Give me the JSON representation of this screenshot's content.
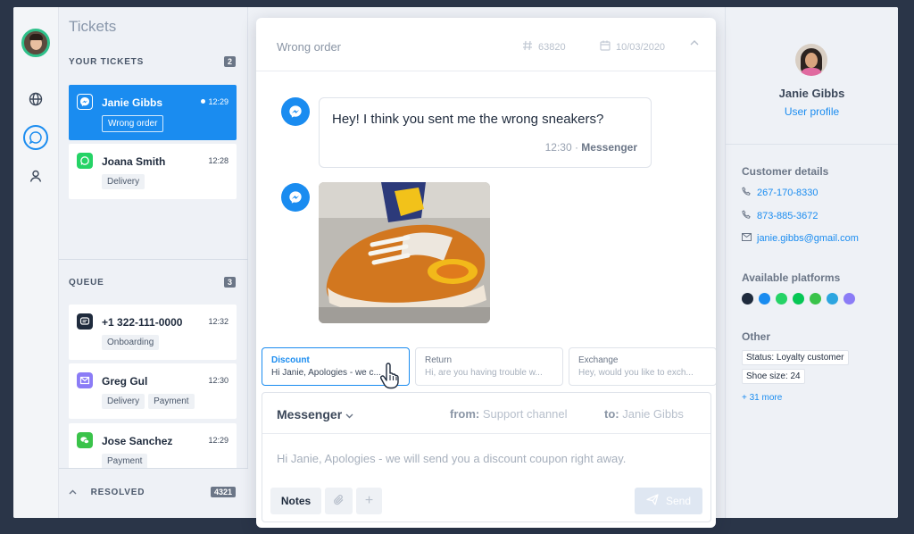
{
  "tickets": {
    "title": "Tickets",
    "your_label": "YOUR TICKETS",
    "your_count": "2",
    "your_items": [
      {
        "name": "Janie Gibbs",
        "time": "12:29",
        "tags": [
          "Wrong order"
        ]
      },
      {
        "name": "Joana Smith",
        "time": "12:28",
        "tags": [
          "Delivery"
        ]
      }
    ],
    "queue_label": "QUEUE",
    "queue_count": "3",
    "queue_items": [
      {
        "name": "+1 322-111-0000",
        "time": "12:32",
        "tags": [
          "Onboarding"
        ]
      },
      {
        "name": "Greg Gul",
        "time": "12:30",
        "tags": [
          "Delivery",
          "Payment"
        ]
      },
      {
        "name": "Jose Sanchez",
        "time": "12:29",
        "tags": [
          "Payment"
        ]
      }
    ],
    "resolved_label": "RESOLVED",
    "resolved_count": "4321"
  },
  "chat": {
    "title": "Wrong order",
    "ticket_id": "63820",
    "date": "10/03/2020",
    "message": "Hey! I think you sent me the wrong sneakers?",
    "message_time": "12:30 · ",
    "message_channel": "Messenger"
  },
  "quick_replies": [
    {
      "title": "Discount",
      "body": "Hi Janie, Apologies - we c..."
    },
    {
      "title": "Return",
      "body": "Hi, are you having trouble w..."
    },
    {
      "title": "Exchange",
      "body": "Hey, would you like to exch..."
    }
  ],
  "composer": {
    "channel": "Messenger",
    "from_label": "from:",
    "from_value": "Support channel",
    "to_label": "to:",
    "to_value": "Janie Gibbs",
    "text": "Hi Janie, Apologies - we will send you a discount coupon right away.",
    "notes_label": "Notes",
    "add_label": "+",
    "send_label": "Send"
  },
  "customer": {
    "name": "Janie Gibbs",
    "profile_link": "User profile",
    "details_label": "Customer details",
    "phone1": "267-170-8330",
    "phone2": "873-885-3672",
    "email": "janie.gibbs@gmail.com",
    "platforms_label": "Available platforms",
    "other_label": "Other",
    "other_tags": [
      "Status: Loyalty customer",
      "Shoe size: 24"
    ],
    "more": "+ 31 more"
  },
  "colors": {
    "accent": "#1a8cf0",
    "active_ring": "#2ec08a",
    "platforms": [
      "#1f2b3d",
      "#1a8cf0",
      "#25d366",
      "#06c755",
      "#3ac34a",
      "#2ca5e0",
      "#8b7cf6"
    ]
  }
}
